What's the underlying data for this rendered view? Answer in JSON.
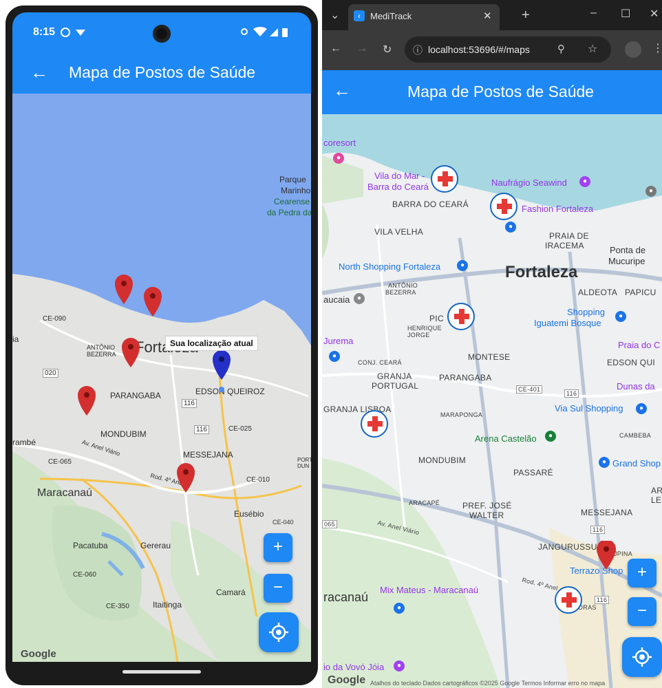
{
  "mobile": {
    "status": {
      "time": "8:15"
    },
    "app_bar": {
      "title": "Mapa de Postos de Saúde"
    },
    "map": {
      "labels": {
        "parque": "Parque",
        "marinho": "Marinho",
        "cearense": "Cearense",
        "pedra": "da Pedra da",
        "ce090": "CE-090",
        "fortaleza": "Fortaleza",
        "antonio_bezerra": "ANTÔNIO\nBEZERRA",
        "r020": "020",
        "parangaba": "PARANGABA",
        "r116a": "116",
        "edson_queiroz": "EDSON QUEIROZ",
        "mondubim": "MONDUBIM",
        "r116b": "116",
        "ce025": "CE-025",
        "rambe": "rambé",
        "ce065": "CE-065",
        "messejana": "MESSEJANA",
        "porto": "PORTO\nDUN",
        "ce010": "CE-010",
        "maracanau": "Maracanaú",
        "eusebio": "Eusébio",
        "ce040": "CE-040",
        "pacatuba": "Pacatuba",
        "gererau": "Gererau",
        "ce060": "CE-060",
        "camara": "Camará",
        "ce350": "CE-350",
        "itaitinga": "Itaitinga",
        "ia": "ia",
        "anel_viario": "Av. Anel Viário",
        "rod4anel": "Rod. 4º Anel"
      },
      "tooltip": "Sua localização atual",
      "google": "Google"
    },
    "controls": {
      "zoom_in": "+",
      "zoom_out": "−"
    }
  },
  "browser": {
    "tab": {
      "title": "MediTrack",
      "favicon": "‹"
    },
    "url": "localhost:53696/#/maps",
    "app_bar": {
      "title": "Mapa de Postos de Saúde"
    },
    "map": {
      "labels": {
        "coresort": "coresort",
        "vila_do_mar": "Vila do Mar -",
        "barra_do_ceara_poi": "Barra do Ceará",
        "naufragio": "Naufrágio Seawind",
        "barra_do_ceara": "BARRA DO CEARÁ",
        "fashion": "Fashion Fortaleza",
        "vila_velha": "VILA VELHA",
        "praia_de": "PRAIA DE",
        "iracema": "IRACEMA",
        "ponta_de": "Ponta de",
        "mucuripe": "Mucuripe",
        "north_shopping": "North Shopping Fortaleza",
        "fortaleza": "Fortaleza",
        "antonio": "ANTÔNIO",
        "bezerra": "BEZERRA",
        "aldeota": "ALDEOTA",
        "papicu": "PAPICU",
        "aucaia": "aucaia",
        "shopping": "Shopping",
        "iguatemi": "Iguatemi Bosque",
        "pic": "PIC",
        "henrique_jorge": "HENRIQUE\nJORGE",
        "jurema": "Jurema",
        "praia_do": "Praia do C",
        "conj_ceara": "CONJ. CEARÁ",
        "montese": "MONTESE",
        "edson_qui": "EDSON QUI",
        "granja": "GRANJA",
        "portugal": "PORTUGAL",
        "parangaba": "PARANGABA",
        "ce401": "CE-401",
        "r116": "116",
        "dunas": "Dunas da",
        "granja_lisboa": "GRANJA LISBOA",
        "via_sul": "Via Sul Shopping",
        "maraponga": "MARAPONGA",
        "arena": "Arena Castelão",
        "cambeba": "CAMBEBA",
        "mondubim": "MONDUBIM",
        "passare": "PASSARÉ",
        "grand_shop": "Grand Shop",
        "ar": "AR",
        "le": "LE",
        "aracape": "ARACAPÉ",
        "pref_jose": "PREF. JOSÉ",
        "walter": "WALTER",
        "messejana": "MESSEJANA",
        "r065": "065",
        "anel_viario": "Av. Anel Viário",
        "r116b": "116",
        "jangurussu": "JANGURUSSU",
        "jpina": "JPINA",
        "terrazo": "Terrazo Shop",
        "rod4anel": "Rod. 4º Anel",
        "mix_mateus": "Mix Mateus - Maracanaú",
        "racanau": "racanaú",
        "r116c": "116",
        "oras": "ORAS",
        "ia_da_vovo": "io da Vovó Jóia",
        "google": "Google",
        "attribution": "Atalhos do teclado   Dados cartográficos ©2025 Google   Termos   Informar erro no mapa"
      }
    },
    "controls": {
      "zoom_in": "+",
      "zoom_out": "−"
    }
  }
}
